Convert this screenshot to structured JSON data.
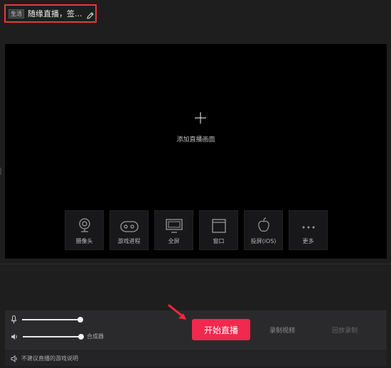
{
  "header": {
    "category_tag": "生活",
    "room_title": "随缘直播，签..."
  },
  "preview": {
    "add_label": "添加直播画面",
    "sources": [
      {
        "label": "摄像头",
        "icon": "webcam-icon"
      },
      {
        "label": "游戏进程",
        "icon": "gamepad-icon"
      },
      {
        "label": "全屏",
        "icon": "monitor-icon"
      },
      {
        "label": "窗口",
        "icon": "window-icon"
      },
      {
        "label": "投屏(iOS)",
        "icon": "apple-icon"
      },
      {
        "label": "更多",
        "icon": "more-icon"
      }
    ]
  },
  "controls": {
    "mic_volume": 1.0,
    "speaker_volume": 1.0,
    "mixer_label": "合成器",
    "start_button": "开始直播",
    "record_video": "录制视频",
    "playback_record": "回放录制"
  },
  "footer": {
    "notice": "不建议直播的游戏说明"
  },
  "colors": {
    "accent": "#f1294f",
    "highlight_border": "#e53935"
  }
}
